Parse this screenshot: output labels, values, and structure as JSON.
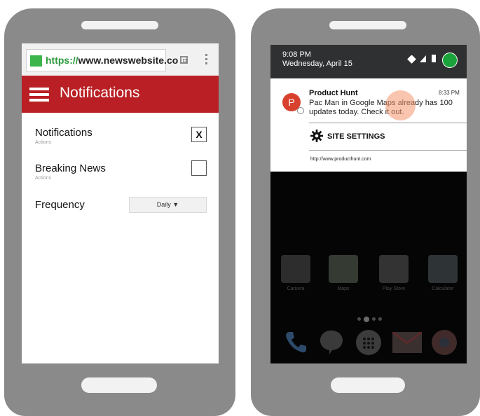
{
  "left_phone": {
    "url_scheme": "https://",
    "url_host": "www.newswebsite.co",
    "appbar_title": "Notifications",
    "settings": [
      {
        "label": "Notifications",
        "sub": "Actions",
        "checked_mark": "X"
      },
      {
        "label": "Breaking News",
        "sub": "Actions",
        "checked_mark": ""
      }
    ],
    "frequency_label": "Frequency",
    "frequency_value": "Daily ▼"
  },
  "right_phone": {
    "status_time": "9:08 PM",
    "status_date": "Wednesday, April 15",
    "notification": {
      "avatar_letter": "P",
      "app_name": "Product Hunt",
      "time": "8:33 PM",
      "body": "Pac Man in Google Maps already has 100 updates today. Check it out.",
      "action_label": "SITE SETTINGS",
      "source_url": "http://www.producthunt.com"
    },
    "apps": [
      {
        "label": "Camera",
        "icon": "camera-icon"
      },
      {
        "label": "Maps",
        "icon": "maps-icon"
      },
      {
        "label": "Play Store",
        "icon": "play-store-icon"
      },
      {
        "label": "Calculator",
        "icon": "calculator-icon"
      }
    ],
    "dock": [
      "phone-icon",
      "hangouts-icon",
      "app-drawer-icon",
      "gmail-icon",
      "chrome-icon"
    ]
  },
  "colors": {
    "phone_body": "#8a8a8a",
    "appbar_red": "#b91f24",
    "https_green": "#2c9a3c",
    "avatar_red": "#d9412f",
    "status_green": "#1aa33a"
  }
}
